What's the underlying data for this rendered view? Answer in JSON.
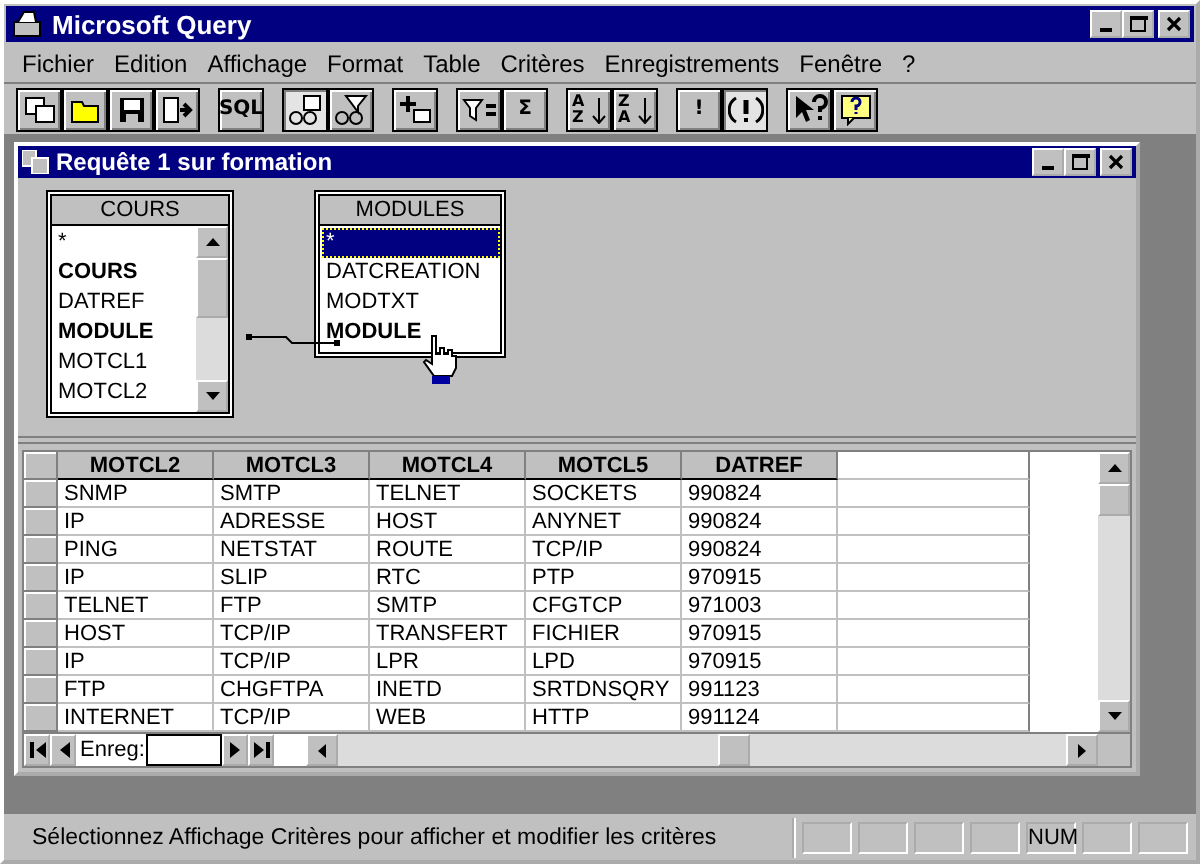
{
  "window": {
    "title": "Microsoft Query"
  },
  "menu": [
    "Fichier",
    "Edition",
    "Affichage",
    "Format",
    "Table",
    "Critères",
    "Enregistrements",
    "Fenêtre",
    "?"
  ],
  "toolbar": [
    [
      {
        "kind": "icon",
        "pressed": false
      },
      {
        "kind": "icon",
        "pressed": false
      },
      {
        "kind": "icon",
        "pressed": false
      },
      {
        "kind": "icon",
        "pressed": false
      }
    ],
    [
      {
        "kind": "text",
        "label": "SQL",
        "pressed": false
      }
    ],
    [
      {
        "kind": "icon",
        "pressed": true
      },
      {
        "kind": "icon",
        "pressed": false
      }
    ],
    [
      {
        "kind": "icon",
        "pressed": false
      }
    ],
    [
      {
        "kind": "icon",
        "pressed": false
      },
      {
        "kind": "text",
        "label": "Σ",
        "pressed": false
      }
    ],
    [
      {
        "kind": "sort",
        "top": "A",
        "bottom": "Z",
        "pressed": false
      },
      {
        "kind": "sort",
        "top": "Z",
        "bottom": "A",
        "pressed": false
      }
    ],
    [
      {
        "kind": "text",
        "label": "!",
        "pressed": false
      },
      {
        "kind": "icon",
        "pressed": true
      }
    ],
    [
      {
        "kind": "icon",
        "pressed": false
      },
      {
        "kind": "icon",
        "pressed": false
      }
    ]
  ],
  "query_window": {
    "title": "Requête 1 sur formation",
    "tables": [
      {
        "name": "COURS",
        "fields": [
          {
            "name": "*",
            "key": false,
            "selected": false
          },
          {
            "name": "COURS",
            "key": true,
            "selected": false
          },
          {
            "name": "DATREF",
            "key": false,
            "selected": false
          },
          {
            "name": "MODULE",
            "key": true,
            "selected": false
          },
          {
            "name": "MOTCL1",
            "key": false,
            "selected": false
          },
          {
            "name": "MOTCL2",
            "key": false,
            "selected": false
          }
        ]
      },
      {
        "name": "MODULES",
        "fields": [
          {
            "name": "*",
            "key": false,
            "selected": true
          },
          {
            "name": "DATCREATION",
            "key": false,
            "selected": false
          },
          {
            "name": "MODTXT",
            "key": false,
            "selected": false
          },
          {
            "name": "MODULE",
            "key": true,
            "selected": false
          }
        ]
      }
    ],
    "grid": {
      "columns": [
        "MOTCL2",
        "MOTCL3",
        "MOTCL4",
        "MOTCL5",
        "DATREF"
      ],
      "rows": [
        [
          "SNMP",
          "SMTP",
          "TELNET",
          "SOCKETS",
          "990824"
        ],
        [
          "IP",
          "ADRESSE",
          "HOST",
          "ANYNET",
          "990824"
        ],
        [
          "PING",
          "NETSTAT",
          "ROUTE",
          "TCP/IP",
          "990824"
        ],
        [
          "IP",
          "SLIP",
          "RTC",
          "PTP",
          "970915"
        ],
        [
          "TELNET",
          "FTP",
          "SMTP",
          "CFGTCP",
          "971003"
        ],
        [
          "HOST",
          "TCP/IP",
          "TRANSFERT",
          "FICHIER",
          "970915"
        ],
        [
          "IP",
          "TCP/IP",
          "LPR",
          "LPD",
          "970915"
        ],
        [
          "FTP",
          "CHGFTPA",
          "INETD",
          "SRTDNSQRY",
          "991123"
        ],
        [
          "INTERNET",
          "TCP/IP",
          "WEB",
          "HTTP",
          "991124"
        ]
      ]
    },
    "record_label": "Enreg:"
  },
  "status_bar": {
    "message": "Sélectionnez Affichage Critères pour afficher et modifier les critères",
    "panels": [
      {
        "kind": "empty"
      },
      {
        "kind": "empty"
      },
      {
        "kind": "empty"
      },
      {
        "kind": "empty"
      },
      {
        "kind": "text",
        "label": "NUM"
      },
      {
        "kind": "empty"
      },
      {
        "kind": "empty"
      }
    ]
  }
}
